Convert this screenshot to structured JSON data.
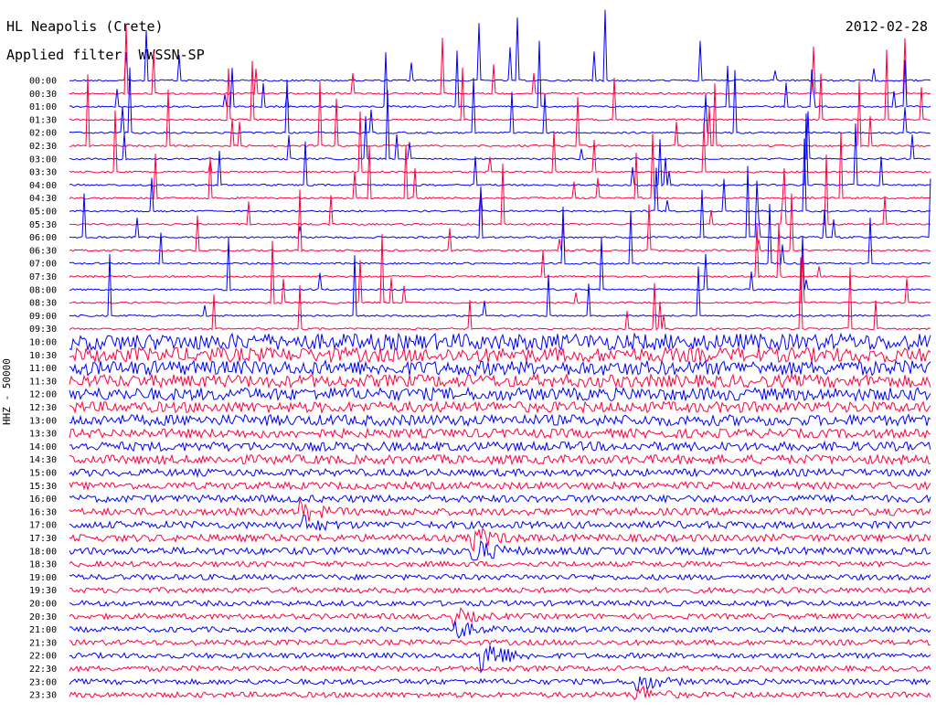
{
  "header": {
    "station": "HL Neapolis (Crete)",
    "date": "2012-02-28",
    "filter": "Applied filter: WWSSN-SP"
  },
  "chart_data": {
    "type": "line",
    "title": "HL Neapolis (Crete)",
    "subtitle": "Applied filter: WWSSN-SP",
    "date": "2012-02-28",
    "ylabel": "HHZ - 50000",
    "xlabel": "",
    "grid": false,
    "legend": "none",
    "colors": [
      "#0000ff",
      "#ff0040"
    ],
    "y_tick_labels": [
      "00:00",
      "00:30",
      "01:00",
      "01:30",
      "02:00",
      "02:30",
      "03:00",
      "03:30",
      "04:00",
      "04:30",
      "05:00",
      "05:30",
      "06:00",
      "06:30",
      "07:00",
      "07:30",
      "08:00",
      "08:30",
      "09:00",
      "09:30",
      "10:00",
      "10:30",
      "11:00",
      "11:30",
      "12:00",
      "12:30",
      "13:00",
      "13:30",
      "14:00",
      "14:30",
      "15:00",
      "15:30",
      "16:00",
      "16:30",
      "17:00",
      "17:30",
      "18:00",
      "18:30",
      "19:00",
      "19:30",
      "20:00",
      "20:30",
      "21:00",
      "21:30",
      "22:00",
      "22:30",
      "23:00",
      "23:30"
    ],
    "row_noise_level": [
      1,
      1,
      1,
      1,
      1,
      1,
      1,
      1,
      1,
      1,
      1,
      1,
      1,
      1,
      1,
      1,
      1,
      1,
      1,
      1,
      9,
      8,
      8,
      7,
      7,
      6,
      6,
      5,
      5,
      5,
      4,
      4,
      4,
      4,
      4,
      4,
      4,
      3,
      3,
      3,
      3,
      3,
      3,
      3,
      3,
      3,
      3,
      3
    ],
    "events": [
      {
        "row": 33,
        "x_fraction": 0.27,
        "amplitude": 10
      },
      {
        "row": 34,
        "x_fraction": 0.27,
        "amplitude": 9
      },
      {
        "row": 35,
        "x_fraction": 0.47,
        "amplitude": 12
      },
      {
        "row": 36,
        "x_fraction": 0.47,
        "amplitude": 14
      },
      {
        "row": 41,
        "x_fraction": 0.45,
        "amplitude": 8
      },
      {
        "row": 42,
        "x_fraction": 0.45,
        "amplitude": 9
      },
      {
        "row": 44,
        "x_fraction": 0.48,
        "amplitude": 25
      },
      {
        "row": 46,
        "x_fraction": 0.66,
        "amplitude": 12
      },
      {
        "row": 47,
        "x_fraction": 0.66,
        "amplitude": 10
      }
    ]
  }
}
